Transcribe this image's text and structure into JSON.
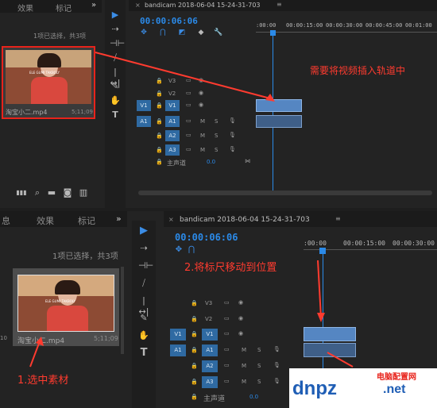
{
  "top": {
    "tabs": [
      "效果",
      "标记"
    ],
    "more": "»",
    "selection_info": "1项已选择，共3项",
    "clip_name": "淘宝小二.mp4",
    "clip_duration": "5;11;09",
    "thumb_text": "ELE GUMI TAKBOLY",
    "sequence_tab": "bandicam 2018-06-04 15-24-31-703",
    "timecode": "00:00:06:06",
    "ruler": [
      ":00:00",
      "00:00:15:00",
      "00:00:30:00",
      "00:00:45:00",
      "00:01:00"
    ],
    "tracks": [
      "V3",
      "V2",
      "V1",
      "A1",
      "A2",
      "A3"
    ],
    "source_v": "V1",
    "source_a": "A1",
    "master_label": "主声道",
    "master_value": "0.0",
    "mute": "M",
    "solo": "S",
    "annotation": "需要将视频插入轨道中"
  },
  "bottom": {
    "tabs": [
      "息",
      "效果",
      "标记"
    ],
    "more": "»",
    "selection_info": "1项已选择，共3项",
    "clip_name": "淘宝小二.mp4",
    "clip_duration": "5;11;09",
    "thumb_text": "ELE GUMI TAKBOLY",
    "edge_number": "10",
    "sequence_tab": "bandicam 2018-06-04 15-24-31-703",
    "timecode": "00:00:06:06",
    "ruler": [
      ":00:00",
      "00:00:15:00",
      "00:00:30:00"
    ],
    "tracks": [
      "V3",
      "V2",
      "V1",
      "A1",
      "A2",
      "A3"
    ],
    "source_v": "V1",
    "source_a": "A1",
    "master_label": "主声道",
    "master_value": "0.0",
    "mute": "M",
    "solo": "S",
    "annotation_select": "1.选中素材",
    "annotation_move": "2.将标尺移动到位置"
  },
  "watermark": {
    "left": "dnpz",
    "right": ".net",
    "cn": "电脑配置网"
  },
  "colors": {
    "accent": "#2b8ae8",
    "annotation": "#ff3b2f",
    "clip": "#5586c2"
  }
}
